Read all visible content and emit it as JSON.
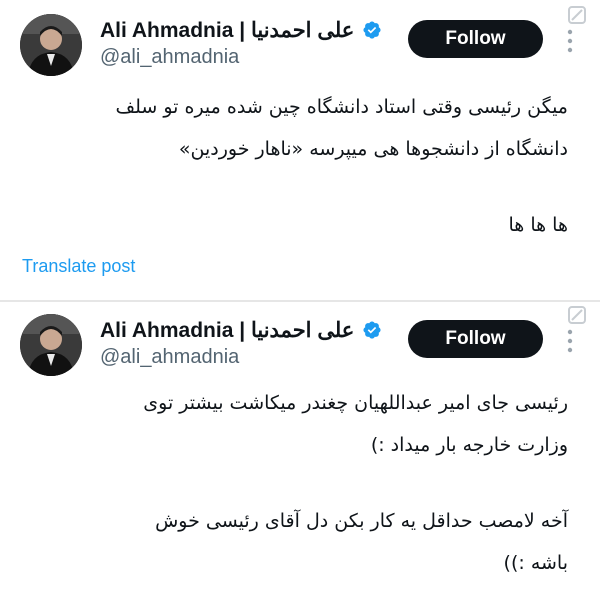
{
  "tweets": [
    {
      "display_name": "Ali Ahmadnia | علی احمدنیا",
      "handle": "@ali_ahmadnia",
      "follow_label": "Follow",
      "paragraphs": [
        "میگن رئیسی وقتی استاد دانشگاه چین شده میره تو سلف",
        "دانشگاه از دانشجوها هی میپرسه «ناهار خوردین»",
        "",
        "ها ها ها"
      ],
      "translate_label": "Translate post"
    },
    {
      "display_name": "Ali Ahmadnia | علی احمدنیا",
      "handle": "@ali_ahmadnia",
      "follow_label": "Follow",
      "paragraphs": [
        "رئیسی جای امیر عبداللهیان چغندر میکاشت بیشتر توی",
        "وزارت خارجه بار میداد :)",
        "",
        "آخه لامصب حداقل یه کار بکن دل آقای رئیسی خوش",
        "باشه :))"
      ]
    }
  ],
  "colors": {
    "accent": "#1d9bf0",
    "follow_bg": "#0f1419",
    "handle": "#536471"
  },
  "icons": [
    "verified-badge-icon",
    "grok-icon",
    "more-options-icon"
  ]
}
